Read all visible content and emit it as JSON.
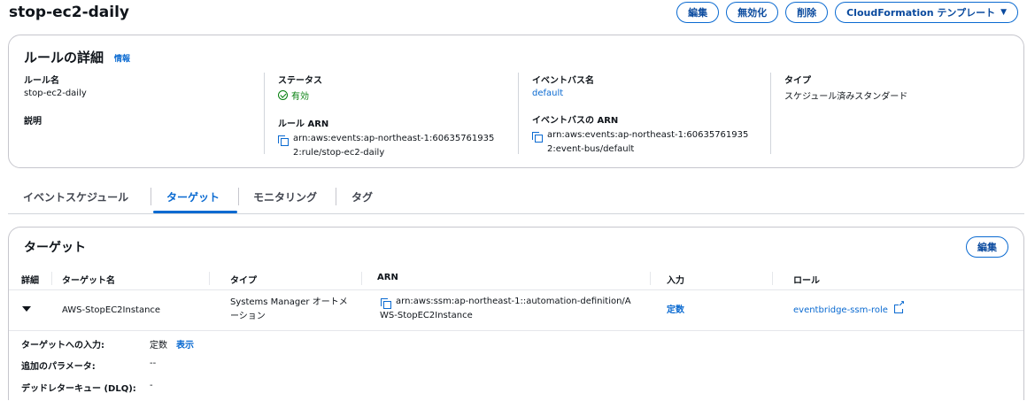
{
  "page": {
    "title": "stop-ec2-daily",
    "actions": {
      "edit": "編集",
      "disable": "無効化",
      "delete": "削除",
      "cfn_template": "CloudFormation テンプレート"
    }
  },
  "details": {
    "heading": "ルールの詳細",
    "info": "情報",
    "rule_name_label": "ルール名",
    "rule_name": "stop-ec2-daily",
    "description_label": "説明",
    "status_label": "ステータス",
    "status": "有効",
    "rule_arn_label": "ルール ARN",
    "rule_arn_line1": "arn:aws:events:ap-northeast-1:60635761935",
    "rule_arn_line2": "2:rule/stop-ec2-daily",
    "event_bus_label": "イベントバス名",
    "event_bus": "default",
    "event_bus_arn_label": "イベントバスの ARN",
    "event_bus_arn_line1": "arn:aws:events:ap-northeast-1:60635761935",
    "event_bus_arn_line2": "2:event-bus/default",
    "type_label": "タイプ",
    "type": "スケジュール済みスタンダード"
  },
  "tabs": [
    "イベントスケジュール",
    "ターゲット",
    "モニタリング",
    "タグ"
  ],
  "targets": {
    "heading": "ターゲット",
    "edit": "編集",
    "columns": [
      "詳細",
      "ターゲット名",
      "タイプ",
      "ARN",
      "入力",
      "ロール"
    ],
    "row": {
      "name": "AWS-StopEC2Instance",
      "type_line1": "Systems Manager オートメ",
      "type_line2": "ーション",
      "arn_line1": "arn:aws:ssm:ap-northeast-1::automation-definition/A",
      "arn_line2": "WS-StopEC2Instance",
      "input": "定数",
      "role": "eventbridge-ssm-role"
    },
    "expanded": {
      "input_label": "ターゲットへの入力:",
      "input_value": "定数",
      "input_show": "表示",
      "params_label": "追加のパラメータ:",
      "params_value": "--",
      "dlq_label": "デッドレターキュー (DLQ):",
      "dlq_value": "-"
    }
  }
}
